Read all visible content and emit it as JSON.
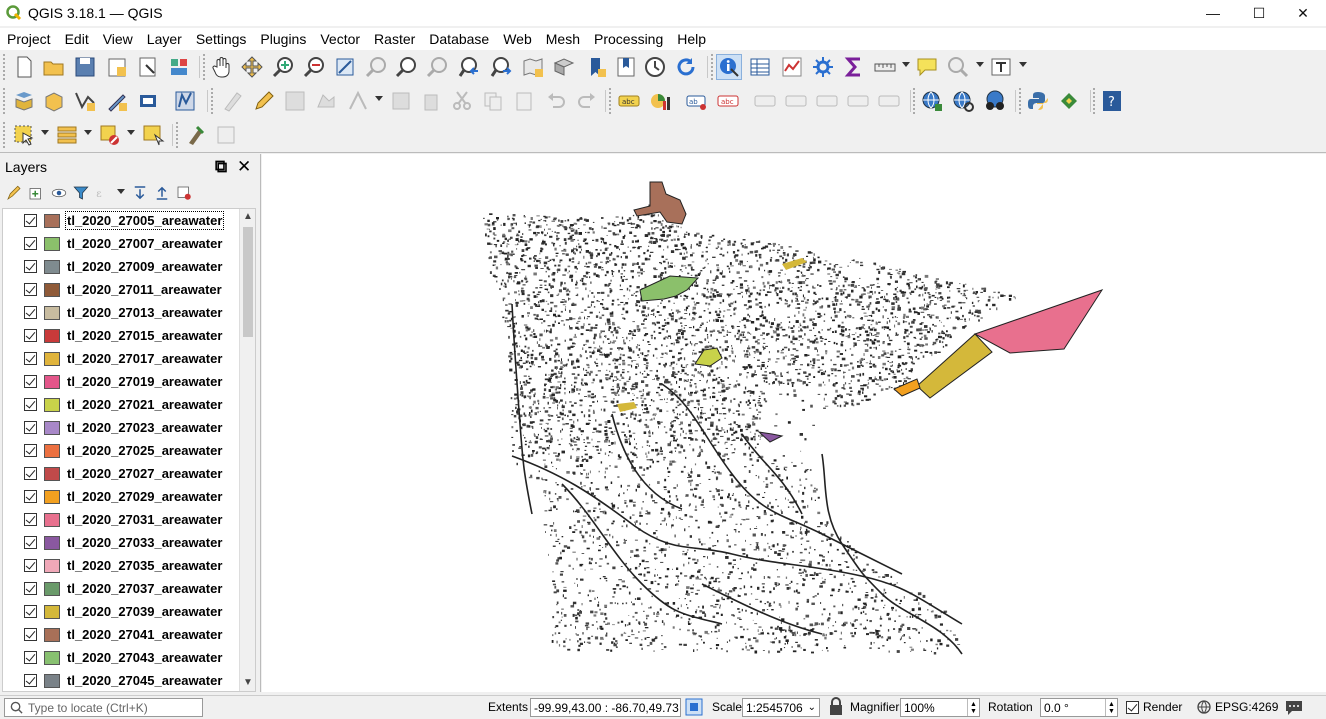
{
  "window": {
    "title": "QGIS 3.18.1 — QGIS",
    "minimize": "—",
    "maximize": "☐",
    "close": "✕"
  },
  "menu": [
    "Project",
    "Edit",
    "View",
    "Layer",
    "Settings",
    "Plugins",
    "Vector",
    "Raster",
    "Database",
    "Web",
    "Mesh",
    "Processing",
    "Help"
  ],
  "layers_panel": {
    "title": "Layers",
    "layers": [
      {
        "name": "tl_2020_27005_areawater",
        "color": "#a8705a"
      },
      {
        "name": "tl_2020_27007_areawater",
        "color": "#8bc06b"
      },
      {
        "name": "tl_2020_27009_areawater",
        "color": "#7f8b8f"
      },
      {
        "name": "tl_2020_27011_areawater",
        "color": "#8f5a38"
      },
      {
        "name": "tl_2020_27013_areawater",
        "color": "#c8bca0"
      },
      {
        "name": "tl_2020_27015_areawater",
        "color": "#c83a3a"
      },
      {
        "name": "tl_2020_27017_areawater",
        "color": "#e0b43c"
      },
      {
        "name": "tl_2020_27019_areawater",
        "color": "#e3568a"
      },
      {
        "name": "tl_2020_27021_areawater",
        "color": "#c8d24a"
      },
      {
        "name": "tl_2020_27023_areawater",
        "color": "#a888c8"
      },
      {
        "name": "tl_2020_27025_areawater",
        "color": "#ec7040"
      },
      {
        "name": "tl_2020_27027_areawater",
        "color": "#c04a4a"
      },
      {
        "name": "tl_2020_27029_areawater",
        "color": "#f2a020"
      },
      {
        "name": "tl_2020_27031_areawater",
        "color": "#e8708e"
      },
      {
        "name": "tl_2020_27033_areawater",
        "color": "#8a58a0"
      },
      {
        "name": "tl_2020_27035_areawater",
        "color": "#f0a8b8"
      },
      {
        "name": "tl_2020_27037_areawater",
        "color": "#6a9a6a"
      },
      {
        "name": "tl_2020_27039_areawater",
        "color": "#d4b83a"
      },
      {
        "name": "tl_2020_27041_areawater",
        "color": "#a87058"
      },
      {
        "name": "tl_2020_27043_areawater",
        "color": "#88c070"
      },
      {
        "name": "tl_2020_27045_areawater",
        "color": "#7a8288"
      }
    ]
  },
  "statusbar": {
    "locate_placeholder": "Type to locate (Ctrl+K)",
    "extents_label": "Extents",
    "extents_value": "-99.99,43.00 : -86.70,49.73",
    "scale_label": "Scale",
    "scale_value": "1:2545706",
    "magnifier_label": "Magnifier",
    "magnifier_value": "100%",
    "rotation_label": "Rotation",
    "rotation_value": "0.0 °",
    "render_label": "Render",
    "crs": "EPSG:4269"
  },
  "map_colors": {
    "lake_pink": "#e8708e",
    "lake_gold": "#d4b83a",
    "lake_orange": "#f2a020",
    "lake_green": "#8bc06b",
    "lake_brown": "#a8705a",
    "lake_purple": "#8a58a0",
    "lake_yellowgreen": "#c8d24a"
  }
}
